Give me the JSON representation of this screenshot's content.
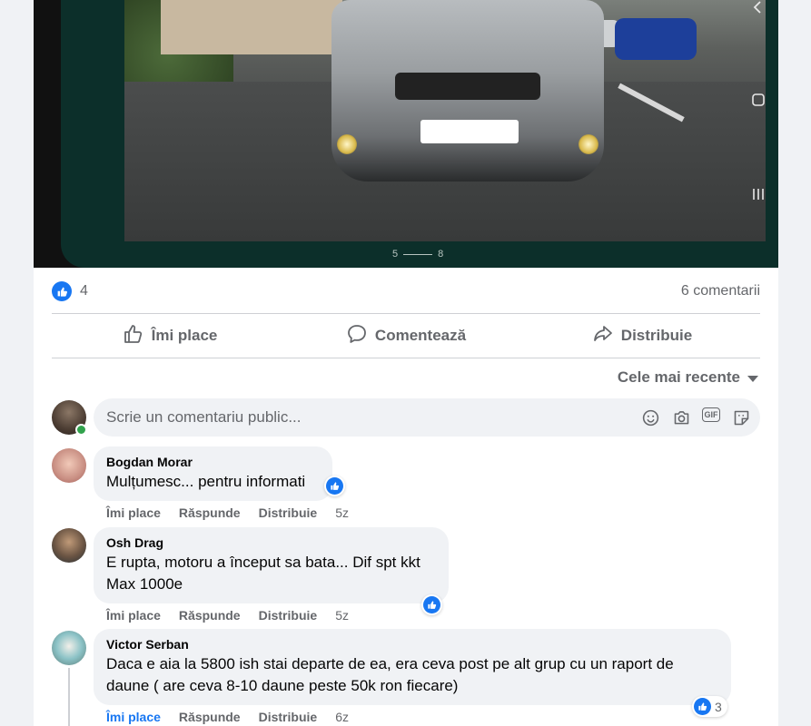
{
  "media": {
    "pager_current": "5",
    "pager_total": "8",
    "side_icons": [
      "chevron-left-icon",
      "home-square-icon",
      "recents-icon"
    ]
  },
  "summary": {
    "like_count": "4",
    "comments_label": "6 comentarii"
  },
  "actions": {
    "like": "Îmi place",
    "comment": "Comentează",
    "share": "Distribuie"
  },
  "sort_label": "Cele mai recente",
  "composer": {
    "placeholder": "Scrie un comentariu public..."
  },
  "comments": [
    {
      "author": "Bogdan Morar",
      "text": "Mulțumesc... pentru informati",
      "like": "Îmi place",
      "reply": "Răspunde",
      "share": "Distribuie",
      "time": "5z",
      "reaction_count": ""
    },
    {
      "author": "Osh Drag",
      "text_line1": "E rupta, motoru a început sa bata... Dif spt kkt",
      "text_line2": "Max 1000e",
      "like": "Îmi place",
      "reply": "Răspunde",
      "share": "Distribuie",
      "time": "5z",
      "reaction_count": ""
    },
    {
      "author": "Victor Serban",
      "text_line1": "Daca e aia la 5800 ish stai departe de ea, era ceva post pe alt grup cu un raport de",
      "text_line2": "daune ( are ceva 8-10 daune peste 50k ron fiecare)",
      "like": "Îmi place",
      "reply": "Răspunde",
      "share": "Distribuie",
      "time": "6z",
      "reaction_count": "3",
      "liked_by_me": true
    }
  ],
  "colors": {
    "accent": "#1877f2",
    "muted_text": "#65676b",
    "bubble": "#f0f2f5",
    "online": "#31a24c",
    "viewer_frame": "#0c2f2a"
  }
}
